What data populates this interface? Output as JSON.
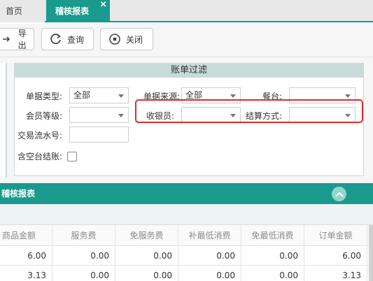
{
  "tabs": {
    "home": "首页",
    "active": "稽核报表",
    "close": "×"
  },
  "toolbar": {
    "export": "导出",
    "query": "查询",
    "close": "关闭"
  },
  "filter": {
    "title": "账单过滤",
    "bill_type_label": "单据类型:",
    "bill_type_value": "全部",
    "bill_source_label": "单据来源:",
    "bill_source_value": "全部",
    "table_label": "餐台:",
    "table_value": "",
    "member_level_label": "会员等级:",
    "member_level_value": "",
    "cashier_label": "收银员:",
    "cashier_value": "",
    "payment_label": "结算方式:",
    "payment_value": "",
    "serial_label": "交易流水号:",
    "serial_value": "",
    "include_empty_label": "含空台结账:",
    "include_empty_checked": false
  },
  "report": {
    "title": "稽核报表",
    "columns": [
      "商品金额",
      "服务费",
      "免服务费",
      "补最低消费",
      "免最低消费",
      "订单金额"
    ],
    "rows": [
      [
        "6.00",
        "0.00",
        "0.00",
        "0.00",
        "0.00",
        "6.00"
      ],
      [
        "3.13",
        "0.00",
        "0.00",
        "0.00",
        "0.00",
        "3.13"
      ]
    ]
  },
  "colors": {
    "accent": "#1a9a8c",
    "highlight": "#e02a2a"
  }
}
